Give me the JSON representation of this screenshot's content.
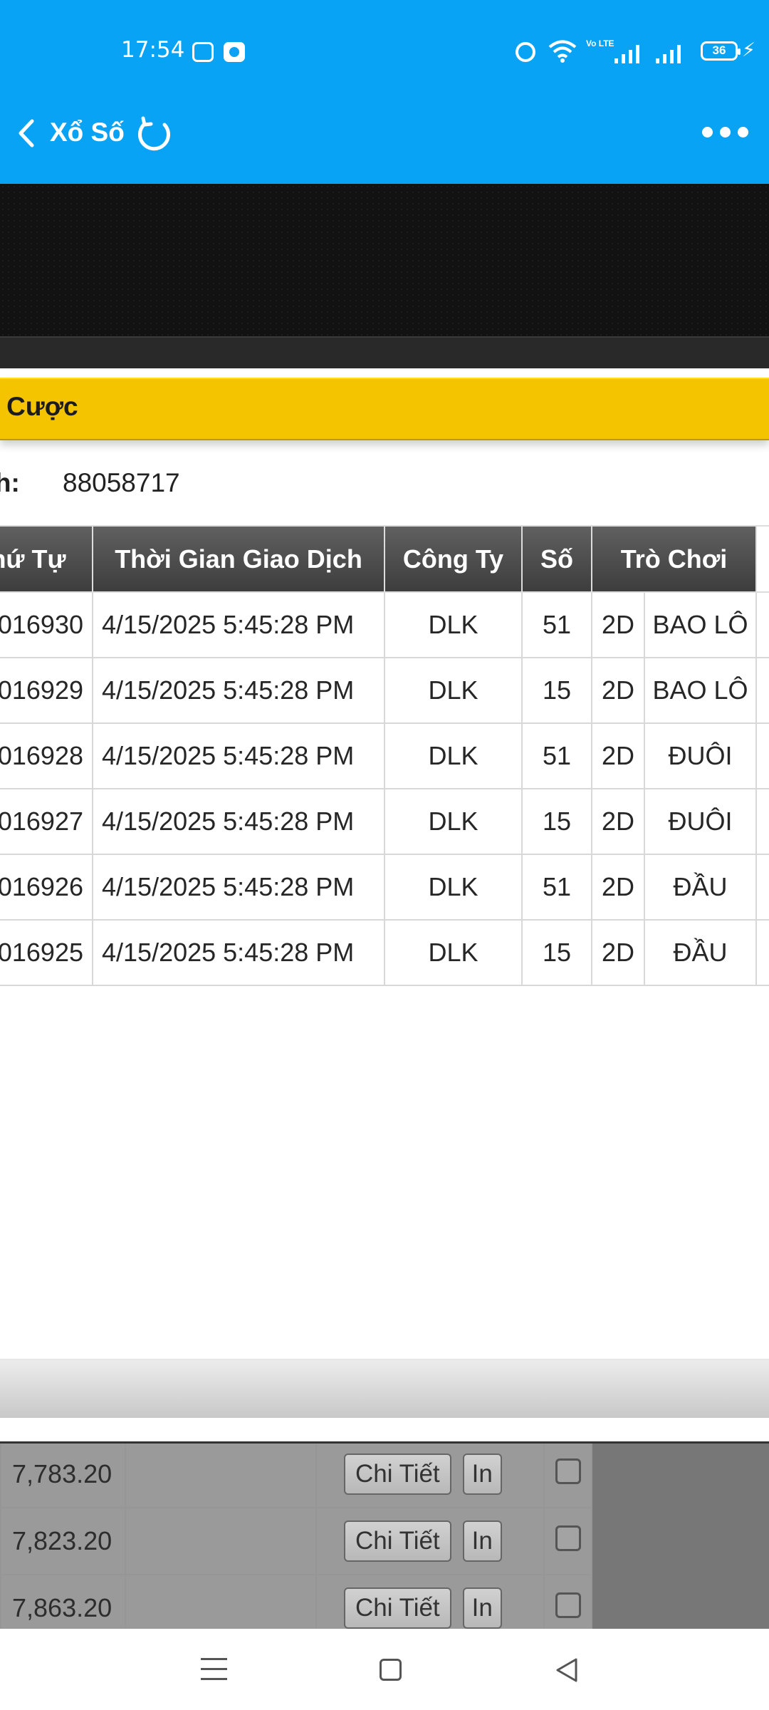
{
  "status_bar": {
    "time": "17:54",
    "battery": "36",
    "network": "Vo LTE",
    "charging": "⚡"
  },
  "app_header": {
    "title": "Xổ Số"
  },
  "section": {
    "title": "ặt Cược"
  },
  "transaction": {
    "label": "ịch:",
    "value": "88058717"
  },
  "bets_table": {
    "headers": [
      "hứ Tự",
      "Thời Gian Giao Dịch",
      "Công Ty",
      "Số",
      "Trò Chơi"
    ],
    "rows": [
      {
        "order": "016930",
        "time": "4/15/2025 5:45:28 PM",
        "company": "DLK",
        "number": "51",
        "digit": "2D",
        "game": "BAO LÔ"
      },
      {
        "order": "016929",
        "time": "4/15/2025 5:45:28 PM",
        "company": "DLK",
        "number": "15",
        "digit": "2D",
        "game": "BAO LÔ"
      },
      {
        "order": "016928",
        "time": "4/15/2025 5:45:28 PM",
        "company": "DLK",
        "number": "51",
        "digit": "2D",
        "game": "ĐUÔI"
      },
      {
        "order": "016927",
        "time": "4/15/2025 5:45:28 PM",
        "company": "DLK",
        "number": "15",
        "digit": "2D",
        "game": "ĐUÔI"
      },
      {
        "order": "016926",
        "time": "4/15/2025 5:45:28 PM",
        "company": "DLK",
        "number": "51",
        "digit": "2D",
        "game": "ĐẦU"
      },
      {
        "order": "016925",
        "time": "4/15/2025 5:45:28 PM",
        "company": "DLK",
        "number": "15",
        "digit": "2D",
        "game": "ĐẦU"
      }
    ]
  },
  "background_rows": [
    {
      "amount": "7,783.20",
      "detail_label": "Chi Tiết",
      "print_label": "In"
    },
    {
      "amount": "7,823.20",
      "detail_label": "Chi Tiết",
      "print_label": "In"
    },
    {
      "amount": "7,863.20",
      "detail_label": "Chi Tiết",
      "print_label": "In"
    }
  ],
  "colors": {
    "header_blue": "#08a3f5",
    "section_yellow": "#f4c400",
    "table_header": "#4b4b4b",
    "overlay_gray": "#777777"
  },
  "icons": [
    "back-icon",
    "refresh-icon",
    "more-icon",
    "menu-icon",
    "home-icon",
    "back-triangle-icon"
  ]
}
